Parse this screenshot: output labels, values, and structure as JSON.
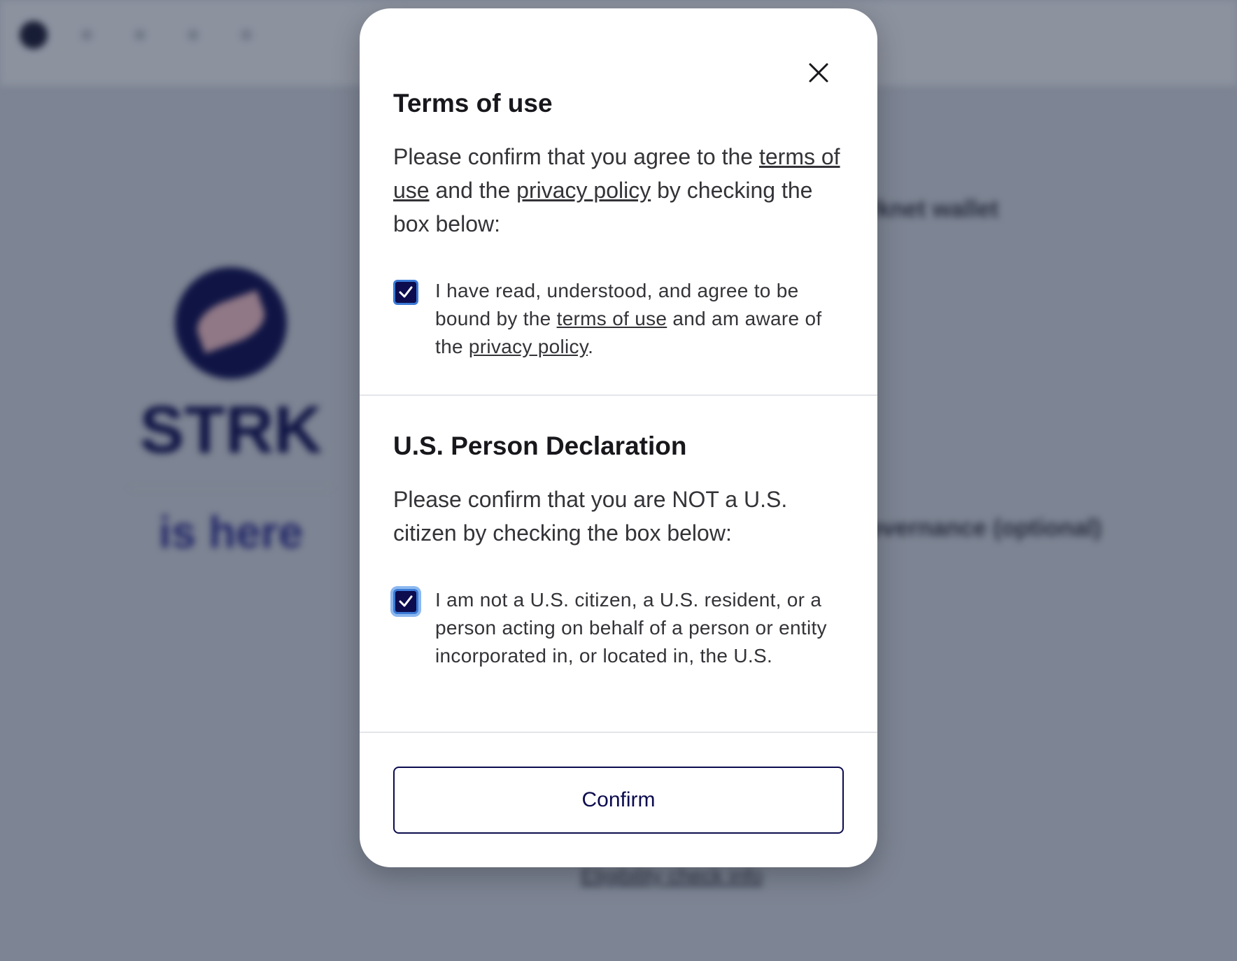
{
  "background": {
    "token_name": "STRK",
    "tagline": "is here",
    "step_wallet": "rknet wallet",
    "step_governance": "overnance (optional)",
    "link_text": "Eligibility check info"
  },
  "modal": {
    "terms": {
      "title": "Terms of use",
      "body_prefix": "Please confirm that you agree to the ",
      "terms_link": "terms of use",
      "body_mid": " and the ",
      "privacy_link": "privacy policy",
      "body_suffix": " by checking the box below:",
      "checkbox_checked": true,
      "check_prefix": "I have read, understood, and agree to be bound by the ",
      "check_terms_link": "terms of use",
      "check_mid": " and am aware of the ",
      "check_privacy_link": "privacy policy",
      "check_suffix": "."
    },
    "us_person": {
      "title": "U.S. Person Declaration",
      "body": "Please confirm that you are NOT a U.S. citizen by checking the box below:",
      "checkbox_checked": true,
      "check_text": "I am not a U.S. citizen, a U.S. resident, or a person acting on behalf of a person or entity incorporated in, or located in, the U.S."
    },
    "confirm_label": "Confirm"
  },
  "colors": {
    "brand_navy": "#0c0c4f",
    "checkbox_focus": "#8cb8f0"
  }
}
